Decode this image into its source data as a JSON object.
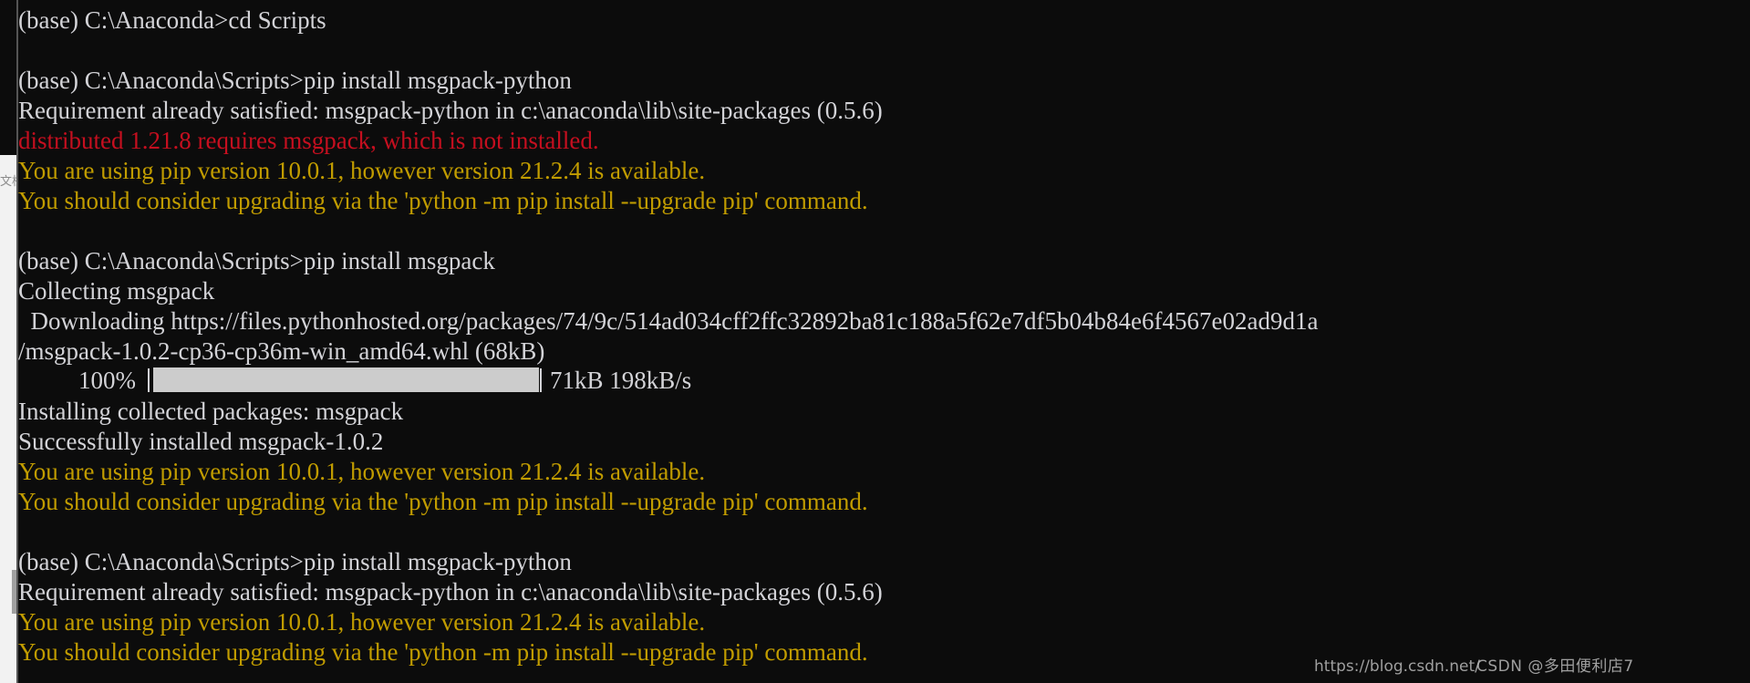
{
  "terminal": {
    "background_color": "#0c0c0c",
    "default_text_color": "#d3d3d7",
    "error_color": "#c50f1f",
    "warning_color": "#c19c00",
    "lines": [
      {
        "id": "l01",
        "text": "(base) C:\\Anaconda>cd Scripts",
        "color": "default"
      },
      {
        "id": "l02",
        "text": "",
        "color": "default"
      },
      {
        "id": "l03",
        "text": "(base) C:\\Anaconda\\Scripts>pip install msgpack-python",
        "color": "default"
      },
      {
        "id": "l04",
        "text": "Requirement already satisfied: msgpack-python in c:\\anaconda\\lib\\site-packages (0.5.6)",
        "color": "default"
      },
      {
        "id": "l05",
        "text": "distributed 1.21.8 requires msgpack, which is not installed.",
        "color": "red"
      },
      {
        "id": "l06",
        "text": "You are using pip version 10.0.1, however version 21.2.4 is available.",
        "color": "yellow"
      },
      {
        "id": "l07",
        "text": "You should consider upgrading via the 'python -m pip install --upgrade pip' command.",
        "color": "yellow"
      },
      {
        "id": "l08",
        "text": "",
        "color": "default"
      },
      {
        "id": "l09",
        "text": "(base) C:\\Anaconda\\Scripts>pip install msgpack",
        "color": "default"
      },
      {
        "id": "l10",
        "text": "Collecting msgpack",
        "color": "default"
      },
      {
        "id": "l11",
        "text": "  Downloading https://files.pythonhosted.org/packages/74/9c/514ad034cff2ffc32892ba81c188a5f62e7df5b04b84e6f4567e02ad9d1a",
        "color": "default"
      },
      {
        "id": "l12",
        "text": "/msgpack-1.0.2-cp36-cp36m-win_amd64.whl (68kB)",
        "color": "default"
      },
      {
        "id": "l13",
        "text": "PROGRESS_BAR",
        "color": "default"
      },
      {
        "id": "l14",
        "text": "Installing collected packages: msgpack",
        "color": "default"
      },
      {
        "id": "l15",
        "text": "Successfully installed msgpack-1.0.2",
        "color": "default"
      },
      {
        "id": "l16",
        "text": "You are using pip version 10.0.1, however version 21.2.4 is available.",
        "color": "yellow"
      },
      {
        "id": "l17",
        "text": "You should consider upgrading via the 'python -m pip install --upgrade pip' command.",
        "color": "yellow"
      },
      {
        "id": "l18",
        "text": "",
        "color": "default"
      },
      {
        "id": "l19",
        "text": "(base) C:\\Anaconda\\Scripts>pip install msgpack-python",
        "color": "default"
      },
      {
        "id": "l20",
        "text": "Requirement already satisfied: msgpack-python in c:\\anaconda\\lib\\site-packages (0.5.6)",
        "color": "default"
      },
      {
        "id": "l21",
        "text": "You are using pip version 10.0.1, however version 21.2.4 is available.",
        "color": "yellow"
      },
      {
        "id": "l22",
        "text": "You should consider upgrading via the 'python -m pip install --upgrade pip' command.",
        "color": "yellow"
      }
    ],
    "progress": {
      "percent_label": "100%",
      "percent_value": 100,
      "downloaded": "71kB",
      "rate": "198kB/s",
      "rate_line": "71kB 198kB/s"
    }
  },
  "background_window": {
    "glyph_column": "文档\n器"
  },
  "watermark": {
    "url_text": "https://blog.csdn.net/",
    "author_text": "CSDN @多田便利店7"
  }
}
